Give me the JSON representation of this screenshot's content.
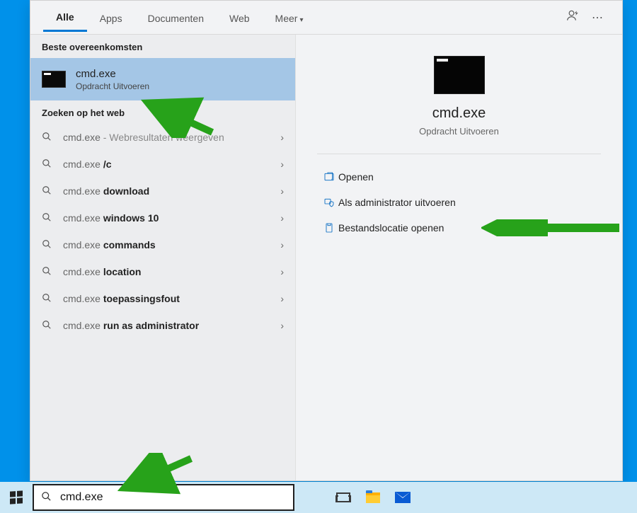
{
  "tabs": {
    "all": "Alle",
    "apps": "Apps",
    "docs": "Documenten",
    "web": "Web",
    "more": "Meer"
  },
  "sections": {
    "best": "Beste overeenkomsten",
    "web": "Zoeken op het web"
  },
  "best_match": {
    "title": "cmd.exe",
    "subtitle": "Opdracht Uitvoeren"
  },
  "web_suggestions": [
    {
      "pre": "cmd.exe",
      "bold": "",
      "hint": " - Webresultaten weergeven"
    },
    {
      "pre": "cmd.exe ",
      "bold": "/c",
      "hint": ""
    },
    {
      "pre": "cmd.exe ",
      "bold": "download",
      "hint": ""
    },
    {
      "pre": "cmd.exe ",
      "bold": "windows 10",
      "hint": ""
    },
    {
      "pre": "cmd.exe ",
      "bold": "commands",
      "hint": ""
    },
    {
      "pre": "cmd.exe ",
      "bold": "location",
      "hint": ""
    },
    {
      "pre": "cmd.exe ",
      "bold": "toepassingsfout",
      "hint": ""
    },
    {
      "pre": "cmd.exe ",
      "bold": "run as administrator",
      "hint": ""
    }
  ],
  "preview": {
    "name": "cmd.exe",
    "desc": "Opdracht Uitvoeren"
  },
  "actions": {
    "open": "Openen",
    "admin": "Als administrator uitvoeren",
    "location": "Bestandslocatie openen"
  },
  "search_value": "cmd.exe",
  "colors": {
    "accent": "#0078d4",
    "annotation": "#27a21a"
  }
}
